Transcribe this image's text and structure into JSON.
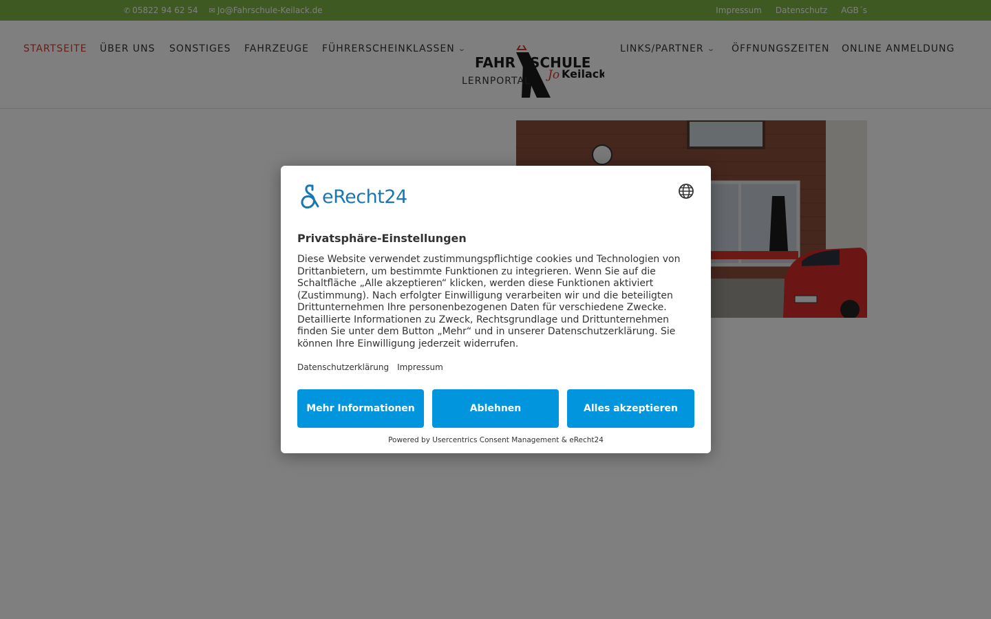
{
  "topbar": {
    "phone": "05822 94 62 54",
    "email": "Jo@Fahrschule-Keilack.de",
    "links": [
      "Impressum",
      "Datenschutz",
      "AGB´s"
    ]
  },
  "nav": {
    "items": [
      {
        "label": "STARTSEITE"
      },
      {
        "label": "ÜBER UNS"
      },
      {
        "label": "SONSTIGES"
      },
      {
        "label": "FAHRZEUGE"
      },
      {
        "label": "FÜHRERSCHEINKLASSEN"
      },
      {
        "label": "LINKS/PARTNER"
      },
      {
        "label": "ÖFFNUNGSZEITEN"
      },
      {
        "label": "ONLINE ANMELDUNG"
      },
      {
        "label": "LERNPORTAL"
      }
    ]
  },
  "logo": {
    "line1": "FAHRSCHULE",
    "line2": "Jo Keilack"
  },
  "consent": {
    "brand": "eRecht24",
    "title": "Privatsphäre-Einstellungen",
    "description": "Diese Website verwendet zustimmungspflichtige cookies und Technologien von Drittanbietern, um bestimmte Funktionen zu integrieren. Wenn Sie auf die Schaltfläche „Alle akzeptieren“ klicken, werden diese Funktionen aktiviert (Zustimmung). Nach erfolgter Einwilligung verarbeiten wir und die beteiligten Drittunternehmen Ihre personenbezogenen Daten für verschiedene Zwecke. Detaillierte Informationen zu Zweck, Rechtsgrundlage und Drittunternehmen finden Sie unter dem Button „Mehr“ und in unserer Datenschutzerklärung. Sie können Ihre Einwilligung jederzeit widerrufen.",
    "link_privacy": "Datenschutzerklärung",
    "link_imprint": "Impressum",
    "btn_more": "Mehr Informationen",
    "btn_decline": "Ablehnen",
    "btn_accept": "Alles akzeptieren",
    "powered": "Powered by Usercentrics Consent Management & eRecht24"
  },
  "colors": {
    "topbar": "#7cb342",
    "active_nav": "#d9352b",
    "button": "#0095dc",
    "brand": "#1976b2"
  }
}
